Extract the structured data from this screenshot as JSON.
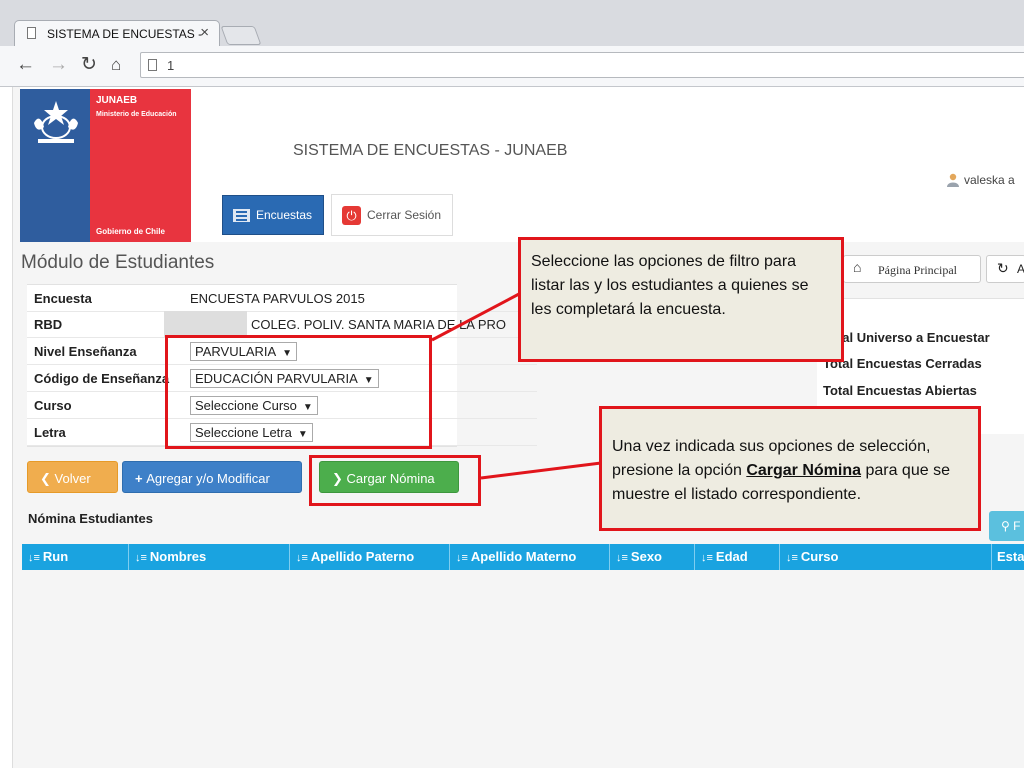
{
  "browser": {
    "tab_title": "SISTEMA DE ENCUESTAS -",
    "tab_close": "×",
    "url": "1"
  },
  "header": {
    "brand": "JUNAEB",
    "ministry": "Ministerio de Educación",
    "government": "Gobierno de Chile",
    "app_title": "SISTEMA DE ENCUESTAS - JUNAEB",
    "user_name": "valeska a"
  },
  "nav": {
    "surveys_label": "Encuestas",
    "logout_label": "Cerrar Sesión"
  },
  "module": {
    "title": "Módulo de Estudiantes",
    "home_label": "Página  Principal",
    "refresh_extra": "A"
  },
  "form": {
    "rows": [
      {
        "label": "Encuesta",
        "value": "ENCUESTA PARVULOS 2015"
      },
      {
        "label": "RBD",
        "value": "COLEG. POLIV. SANTA MARIA DE LA PRO"
      },
      {
        "label": "Nivel Enseñanza",
        "value": "PARVULARIA"
      },
      {
        "label": "Código de Enseñanza",
        "value": "EDUCACIÓN PARVULARIA"
      },
      {
        "label": "Curso",
        "value": "Seleccione Curso"
      },
      {
        "label": "Letra",
        "value": "Seleccione Letra"
      }
    ]
  },
  "stats": {
    "universe": "Total Universo a Encuestar",
    "closed": "Total Encuestas Cerradas",
    "open": "Total Encuestas Abiertas"
  },
  "actions": {
    "back": "Volver",
    "add_modify": "Agregar y/o Modificar",
    "load": "Cargar Nómina",
    "search": "F"
  },
  "list": {
    "title": "Nómina Estudiantes",
    "columns": [
      "Run",
      "Nombres",
      "Apellido Paterno",
      "Apellido Materno",
      "Sexo",
      "Edad",
      "Curso",
      "Esta"
    ]
  },
  "callouts": {
    "filter": "Seleccione las opciones  de filtro para listar las y los estudiantes a quienes se les completará la encuesta.",
    "load_prefix": "Una vez indicada sus opciones de selección, presione la opción ",
    "load_bold": "Cargar Nómina",
    "load_suffix": " para que se muestre el listado correspondiente."
  },
  "colors": {
    "accent_blue": "#2a6ab3",
    "table_header": "#1aa3e0",
    "warning": "#f0ad4e",
    "success": "#4cae4c",
    "callout_border": "#e1151b",
    "callout_fill": "#eeece1"
  },
  "icons": [
    "document-icon",
    "back-arrow-icon",
    "forward-arrow-icon",
    "reload-icon",
    "home-icon",
    "user-icon",
    "list-icon",
    "power-icon",
    "refresh-icon",
    "chevron-left-icon",
    "plus-icon",
    "chevron-right-icon",
    "search-icon",
    "sort-icon"
  ]
}
